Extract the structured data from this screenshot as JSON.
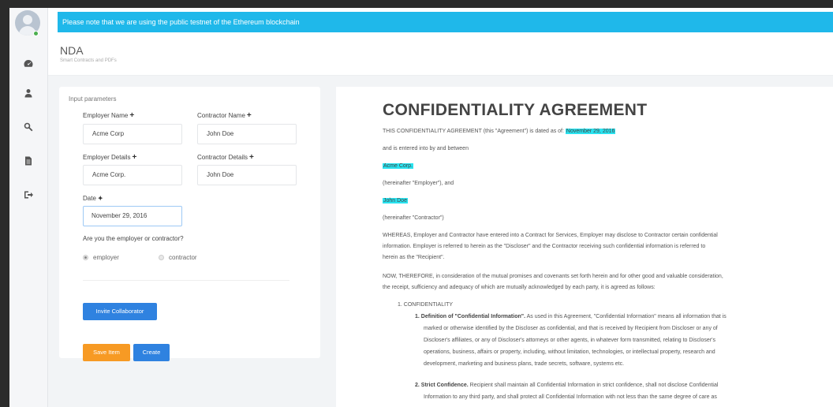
{
  "notice": "Please note that we are using the public testnet of the Ethereum blockchain",
  "header": {
    "title": "NDA",
    "subtitle": "Smart Contracts and PDFs"
  },
  "sidebar": {
    "icons": [
      "dashboard-icon",
      "user-icon",
      "key-search-icon",
      "document-icon",
      "logout-icon"
    ]
  },
  "form": {
    "section_label": "Input parameters",
    "employer_name_label": "Employer Name",
    "employer_name_value": "Acme Corp",
    "contractor_name_label": "Contractor Name",
    "contractor_name_value": "John Doe",
    "employer_details_label": "Employer Details",
    "employer_details_value": "Acme Corp.",
    "contractor_details_label": "Contractor Details",
    "contractor_details_value": "John Doe",
    "date_label": "Date",
    "date_value": "November 29, 2016",
    "question": "Are you the employer or contractor?",
    "radio_employer": "employer",
    "radio_contractor": "contractor",
    "selected_role": "employer",
    "invite_button": "Invite Collaborator",
    "save_button": "Save Item",
    "create_button": "Create"
  },
  "doc": {
    "title": "CONFIDENTIALITY AGREEMENT",
    "intro_prefix": "THIS CONFIDENTIALITY AGREEMENT (this \"Agreement\") is dated as of:",
    "date": "November 29, 2016",
    "entered": "and is entered into by and between",
    "employer": "Acme Corp.",
    "employer_hereinafter": "(hereinafter \"Employer\"), and",
    "contractor": "John Doe",
    "contractor_hereinafter": "(hereinafter \"Contractor\")",
    "whereas_1": "WHEREAS, Employer and Contractor have entered into a Contract for Services, Employer may disclose to Contractor certain confidential",
    "whereas_2": "information. Employer is referred to herein as the \"Discloser\" and the Contractor receiving such confidential information is referred to",
    "whereas_3": "herein as the \"Recipient\".",
    "now_1": "NOW, THEREFORE, in consideration of the mutual promises and covenants set forth herein and for other good and valuable consideration,",
    "now_2": "the receipt, sufficiency and adequacy of which are mutually acknowledged by each party, it is agreed as follows:",
    "section_1": "1. CONFIDENTIALITY",
    "def_bold": "1. Definition of \"Confidential Information\".",
    "def_1": "As used in this Agreement, \"Confidential Information\" means all information that is",
    "def_2": "marked or otherwise identified by the Discloser as confidential, and that is received by Recipient from Discloser or any of",
    "def_3": "Discloser's affiliates, or any of Discloser's attorneys or other agents, in whatever form transmitted, relating to Discloser's",
    "def_4": "operations, business, affairs or property, including, without limitation, technologies, or intellectual property, research and",
    "def_5": "development, marketing and business plans, trade secrets, software, systems etc.",
    "strict_bold": "2. Strict Confidence.",
    "strict_1": "Recipient shall maintain all Confidential Information in strict confidence, shall not disclose Confidential",
    "strict_2": "Information to any third party, and shall protect all Confidential Information with not less than the same degree of care as"
  }
}
